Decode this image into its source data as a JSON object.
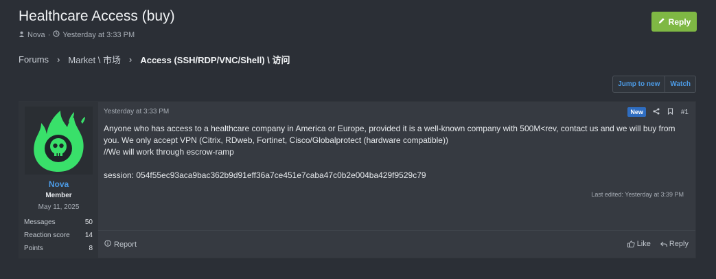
{
  "thread": {
    "title": "Healthcare Access (buy)",
    "author": "Nova",
    "separator": "·",
    "time": "Yesterday at 3:33 PM",
    "reply_label": "Reply"
  },
  "breadcrumb": {
    "items": [
      "Forums",
      "Market \\ 市场",
      "Access (SSH/RDP/VNC/Shell) \\ 访问"
    ],
    "separator": "›"
  },
  "controls": {
    "jump_label": "Jump to new",
    "watch_label": "Watch"
  },
  "post": {
    "date": "Yesterday at 3:33 PM",
    "badge": "New",
    "number": "#1",
    "body": {
      "line1": "Anyone who has access to a healthcare company in America or Europe, provided it is a well-known company with 500M<rev, contact us and we will buy from you. We only accept VPN (Citrix, RDweb, Fortinet, Cisco/Globalprotect (hardware compatible))",
      "line2": "//We will work through escrow-ramp",
      "session": "session: 054f55ec93aca9bac362b9d91eff36a7ce451e7caba47c0b2e004ba429f9529c79"
    },
    "last_edited": "Last edited: Yesterday at 3:39 PM",
    "report_label": "Report",
    "like_label": "Like",
    "reply_label": "Reply"
  },
  "user": {
    "name": "Nova",
    "title": "Member",
    "joined": "May 11, 2025",
    "stats": [
      {
        "label": "Messages",
        "value": "50"
      },
      {
        "label": "Reaction score",
        "value": "14"
      },
      {
        "label": "Points",
        "value": "8"
      }
    ]
  },
  "colors": {
    "accent": "#4c9be6",
    "reply_button": "#7fb844",
    "avatar_green": "#39e06a"
  }
}
